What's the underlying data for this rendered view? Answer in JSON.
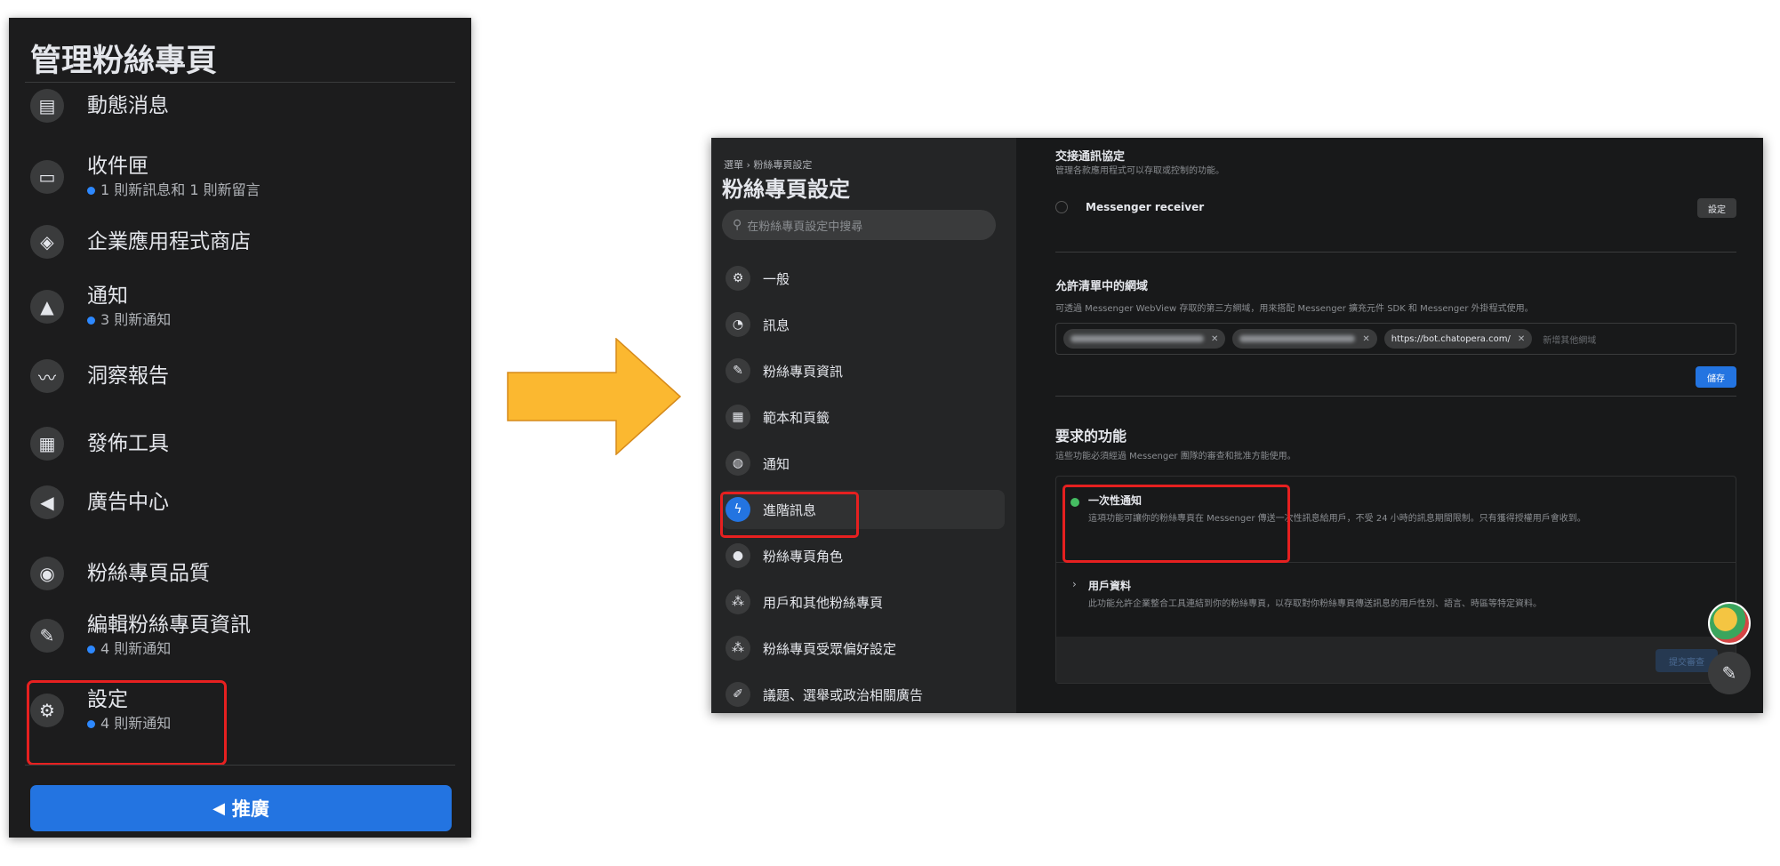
{
  "left_panel": {
    "title": "管理粉絲專頁",
    "items": [
      {
        "label": "動態消息",
        "sub": "",
        "icon": "news-feed-icon"
      },
      {
        "label": "收件匣",
        "sub": "1 則新訊息和 1 則新留言",
        "icon": "inbox-icon"
      },
      {
        "label": "企業應用程式商店",
        "sub": "",
        "icon": "app-store-icon"
      },
      {
        "label": "通知",
        "sub": "3 則新通知",
        "icon": "bell-icon"
      },
      {
        "label": "洞察報告",
        "sub": "",
        "icon": "insights-icon"
      },
      {
        "label": "發佈工具",
        "sub": "",
        "icon": "publishing-tools-icon"
      },
      {
        "label": "廣告中心",
        "sub": "",
        "icon": "megaphone-icon"
      },
      {
        "label": "粉絲專頁品質",
        "sub": "",
        "icon": "shield-icon"
      },
      {
        "label": "編輯粉絲專頁資訊",
        "sub": "4 則新通知",
        "icon": "pencil-icon"
      },
      {
        "label": "設定",
        "sub": "4 則新通知",
        "icon": "gear-icon"
      }
    ],
    "promote_label": "推廣"
  },
  "right_window": {
    "breadcrumb": "選單 › 粉絲專頁設定",
    "title": "粉絲專頁設定",
    "search_placeholder": "在粉絲專頁設定中搜尋",
    "sidebar_items": [
      {
        "label": "一般",
        "icon": "gear-icon"
      },
      {
        "label": "訊息",
        "icon": "chat-icon"
      },
      {
        "label": "粉絲專頁資訊",
        "icon": "pencil-icon"
      },
      {
        "label": "範本和頁籤",
        "icon": "grid-icon"
      },
      {
        "label": "通知",
        "icon": "globe-icon"
      },
      {
        "label": "進階訊息",
        "icon": "messenger-icon"
      },
      {
        "label": "粉絲專頁角色",
        "icon": "person-icon"
      },
      {
        "label": "用戶和其他粉絲專頁",
        "icon": "people-icon"
      },
      {
        "label": "粉絲專頁受眾偏好設定",
        "icon": "people-icon"
      },
      {
        "label": "議題、選舉或政治相關廣告",
        "icon": "brush-icon"
      }
    ],
    "main": {
      "handover": {
        "heading": "交接通訊協定",
        "desc": "管理各款應用程式可以存取或控制的功能。",
        "receiver_label": "Messenger receiver",
        "settings_button": "設定"
      },
      "whitelist": {
        "heading": "允許清單中的網域",
        "desc": "可透過 Messenger WebView 存取的第三方網域，用來搭配 Messenger 擴充元件 SDK 和 Messenger 外掛程式使用。",
        "domains": [
          "https://bot.chatopera.com/"
        ],
        "input_placeholder": "新增其他網域",
        "save_button": "儲存"
      },
      "features": {
        "heading": "要求的功能",
        "desc": "這些功能必須經過 Messenger 團隊的審查和批准方能使用。",
        "items": [
          {
            "title": "一次性通知",
            "desc": "這項功能可讓你的粉絲專頁在 Messenger 傳送一次性訊息給用戶，不受 24 小時的訊息期間限制。只有獲得授權用戶會收到。"
          },
          {
            "title": "用戶資料",
            "desc": "此功能允許企業整合工具連結到你的粉絲專頁，以存取對你粉絲專頁傳送訊息的用戶性別、語言、時區等特定資料。"
          }
        ],
        "submit_button": "提交審查"
      }
    }
  },
  "colors": {
    "panel_bg": "#1c1c1d",
    "accent_blue": "#2374e1",
    "highlight_red": "#e62020",
    "arrow_fill": "#fbb830"
  }
}
